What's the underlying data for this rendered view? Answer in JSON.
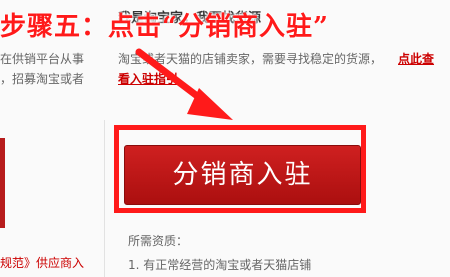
{
  "tutorial": {
    "step_caption": "步骤五：点击“分销商入驻”"
  },
  "left_column": {
    "line1": "在供销平台从事",
    "line2": "，招募淘宝或者",
    "bottom": "规范》供应商入"
  },
  "main": {
    "heading": "我是淘宝家，我要找货源",
    "desc_line1": "淘宝或者天猫的店铺卖家，需要寻找稳定的货源，",
    "desc_link": "点此查",
    "guide_link": "看入驻指引",
    "join_button_label": "分销商入驻",
    "requirements_title": "所需资质：",
    "requirement_1": "1. 有正常经营的淘宝或者天猫店铺"
  },
  "colors": {
    "caption_red": "#ff1a1a",
    "button_red": "#c01818",
    "link_red": "#cc0000"
  }
}
